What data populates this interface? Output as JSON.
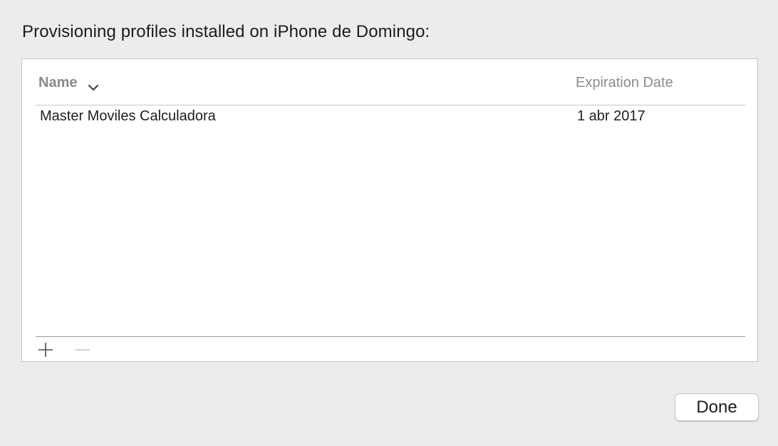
{
  "dialog": {
    "title": "Provisioning profiles installed on iPhone de Domingo:"
  },
  "table": {
    "columns": [
      {
        "label": "Name",
        "sorted": "descending"
      },
      {
        "label": "Expiration Date"
      }
    ],
    "rows": [
      {
        "name": "Master Moviles Calculadora",
        "expiration": "1 abr 2017"
      }
    ]
  },
  "controls": {
    "add_icon": "plus-icon",
    "remove_icon": "minus-icon",
    "remove_enabled": false
  },
  "buttons": {
    "done_label": "Done"
  }
}
